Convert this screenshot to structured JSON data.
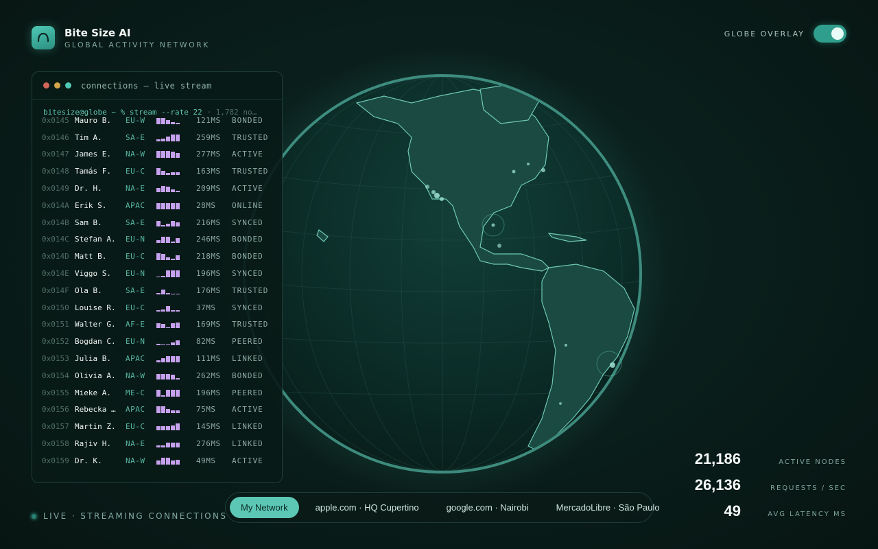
{
  "brand": {
    "name": "Bite Size AI",
    "subtitle": "GLOBAL ACTIVITY NETWORK"
  },
  "overlay": {
    "label": "GLOBE OVERLAY",
    "enabled": true
  },
  "terminal": {
    "title": "connections — live stream",
    "command": "bitesize@globe ~ % stream --rate 22",
    "command_suffix": "· 1,782 no…",
    "rows": [
      {
        "id": "0x0145",
        "name": "Mauro B.",
        "region": "EU-W",
        "bars": [
          8,
          8,
          5,
          3,
          2
        ],
        "ms": "121MS",
        "status": "BONDED"
      },
      {
        "id": "0x0146",
        "name": "Tim A.",
        "region": "SA-E",
        "bars": [
          3,
          4,
          6,
          9,
          9
        ],
        "ms": "259MS",
        "status": "TRUSTED"
      },
      {
        "id": "0x0147",
        "name": "James E.",
        "region": "NA-W",
        "bars": [
          9,
          9,
          9,
          8,
          6
        ],
        "ms": "277MS",
        "status": "ACTIVE"
      },
      {
        "id": "0x0148",
        "name": "Tamás F.",
        "region": "EU-C",
        "bars": [
          9,
          5,
          3,
          4,
          4
        ],
        "ms": "163MS",
        "status": "TRUSTED"
      },
      {
        "id": "0x0149",
        "name": "Dr. H.",
        "region": "NA-E",
        "bars": [
          5,
          8,
          7,
          4,
          2
        ],
        "ms": "209MS",
        "status": "ACTIVE"
      },
      {
        "id": "0x014A",
        "name": "Erik S.",
        "region": "APAC",
        "bars": [
          8,
          8,
          8,
          8,
          8
        ],
        "ms": "28MS",
        "status": "ONLINE"
      },
      {
        "id": "0x014B",
        "name": "Sam B.",
        "region": "SA-E",
        "bars": [
          7,
          2,
          4,
          7,
          5
        ],
        "ms": "216MS",
        "status": "SYNCED"
      },
      {
        "id": "0x014C",
        "name": "Stefan A.",
        "region": "EU-N",
        "bars": [
          4,
          8,
          8,
          2,
          6
        ],
        "ms": "246MS",
        "status": "BONDED"
      },
      {
        "id": "0x014D",
        "name": "Matt B.",
        "region": "EU-C",
        "bars": [
          9,
          8,
          4,
          2,
          6
        ],
        "ms": "218MS",
        "status": "BONDED"
      },
      {
        "id": "0x014E",
        "name": "Viggo S.",
        "region": "EU-N",
        "bars": [
          1,
          2,
          9,
          9,
          9
        ],
        "ms": "196MS",
        "status": "SYNCED"
      },
      {
        "id": "0x014F",
        "name": "Ola B.",
        "region": "SA-E",
        "bars": [
          2,
          6,
          2,
          1,
          1
        ],
        "ms": "176MS",
        "status": "TRUSTED"
      },
      {
        "id": "0x0150",
        "name": "Louise R.",
        "region": "EU-C",
        "bars": [
          2,
          3,
          7,
          2,
          2
        ],
        "ms": "37MS",
        "status": "SYNCED"
      },
      {
        "id": "0x0151",
        "name": "Walter G.",
        "region": "AF-E",
        "bars": [
          6,
          5,
          1,
          6,
          7
        ],
        "ms": "169MS",
        "status": "TRUSTED"
      },
      {
        "id": "0x0152",
        "name": "Bogdan C.",
        "region": "EU-N",
        "bars": [
          2,
          1,
          1,
          4,
          6
        ],
        "ms": "82MS",
        "status": "PEERED"
      },
      {
        "id": "0x0153",
        "name": "Julia B.",
        "region": "APAC",
        "bars": [
          3,
          5,
          8,
          8,
          8
        ],
        "ms": "111MS",
        "status": "LINKED"
      },
      {
        "id": "0x0154",
        "name": "Olivia A.",
        "region": "NA-W",
        "bars": [
          7,
          7,
          7,
          6,
          2
        ],
        "ms": "262MS",
        "status": "BONDED"
      },
      {
        "id": "0x0155",
        "name": "Mieke A.",
        "region": "ME-C",
        "bars": [
          9,
          2,
          9,
          9,
          9
        ],
        "ms": "196MS",
        "status": "PEERED"
      },
      {
        "id": "0x0156",
        "name": "Rebecka …",
        "region": "APAC",
        "bars": [
          9,
          9,
          5,
          4,
          4
        ],
        "ms": "75MS",
        "status": "ACTIVE"
      },
      {
        "id": "0x0157",
        "name": "Martin Z.",
        "region": "EU-C",
        "bars": [
          5,
          5,
          5,
          6,
          9
        ],
        "ms": "145MS",
        "status": "LINKED"
      },
      {
        "id": "0x0158",
        "name": "Rajiv H.",
        "region": "NA-E",
        "bars": [
          3,
          3,
          6,
          6,
          6
        ],
        "ms": "276MS",
        "status": "LINKED"
      },
      {
        "id": "0x0159",
        "name": "Dr. K.",
        "region": "NA-W",
        "bars": [
          5,
          9,
          9,
          5,
          6
        ],
        "ms": "49MS",
        "status": "ACTIVE"
      }
    ]
  },
  "live_label": "LIVE · STREAMING CONNECTIONS",
  "tabs": [
    {
      "label": "My Network",
      "active": true
    },
    {
      "label": "apple.com · HQ Cupertino",
      "active": false
    },
    {
      "label": "google.com · Nairobi",
      "active": false
    },
    {
      "label": "MercadoLibre · São Paulo",
      "active": false
    }
  ],
  "stats": [
    {
      "value": "21,186",
      "label": "ACTIVE NODES"
    },
    {
      "value": "26,136",
      "label": "REQUESTS / SEC"
    },
    {
      "value": "49",
      "label": "AVG LATENCY MS"
    }
  ],
  "colors": {
    "accent": "#5cc7b5",
    "bar": "#c6a2ee",
    "dot_red": "#d0655a",
    "dot_yellow": "#d3a64a",
    "dot_teal": "#4fc9b5"
  },
  "icons": {
    "logo": "arc-logo-icon"
  }
}
